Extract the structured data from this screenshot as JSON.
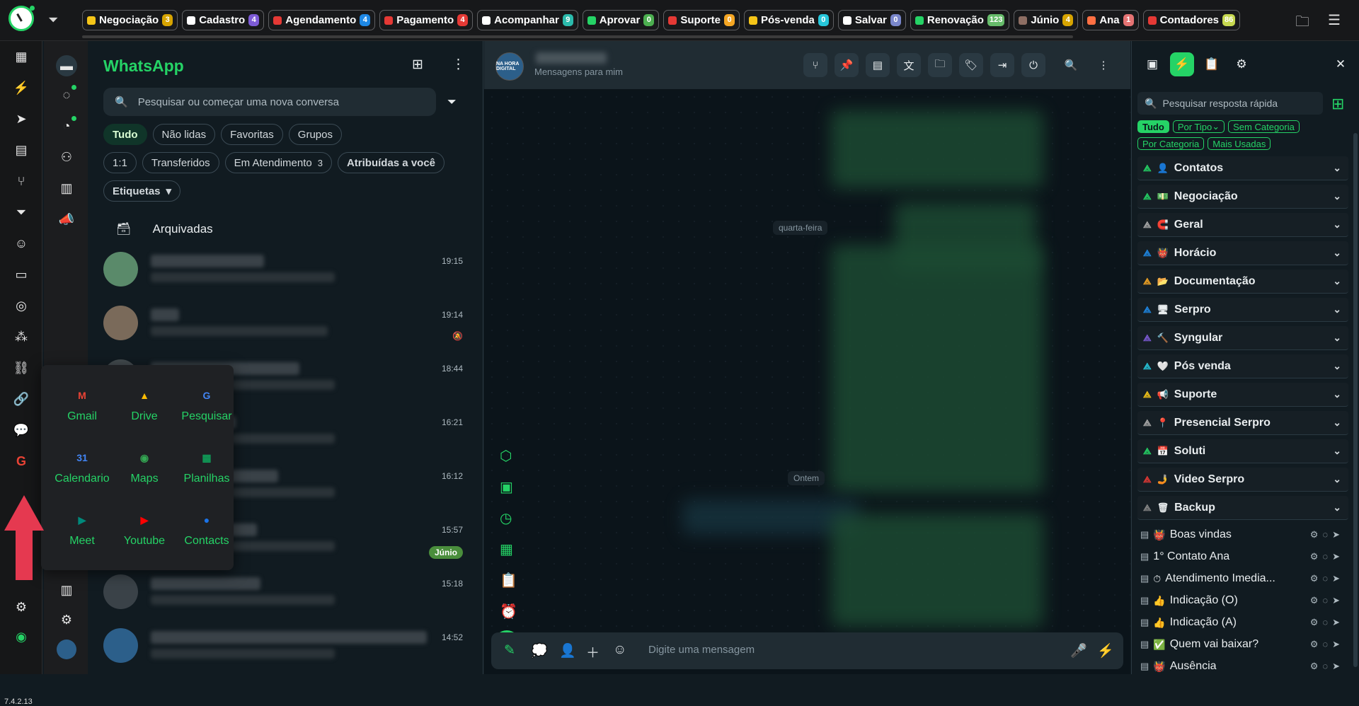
{
  "topbar": {
    "tags": [
      {
        "label": "Negociação",
        "count": "3",
        "color": "#f5c518",
        "count_bg": "#d7a400"
      },
      {
        "label": "Cadastro",
        "count": "4",
        "color": "#ffffff",
        "count_bg": "#7d5bd6"
      },
      {
        "label": "Agendamento",
        "count": "4",
        "color": "#e53935",
        "count_bg": "#1e88e5"
      },
      {
        "label": "Pagamento",
        "count": "4",
        "color": "#e53935",
        "count_bg": "#e53935"
      },
      {
        "label": "Acompanhar",
        "count": "9",
        "color": "#ffffff",
        "count_bg": "#2bbbad"
      },
      {
        "label": "Aprovar",
        "count": "0",
        "color": "#25d366",
        "count_bg": "#4caf50"
      },
      {
        "label": "Suporte",
        "count": "0",
        "color": "#e53935",
        "count_bg": "#f5a623"
      },
      {
        "label": "Pós-venda",
        "count": "0",
        "color": "#f5c518",
        "count_bg": "#26c6da"
      },
      {
        "label": "Salvar",
        "count": "0",
        "color": "#ffffff",
        "count_bg": "#7986cb"
      },
      {
        "label": "Renovação",
        "count": "123",
        "color": "#25d366",
        "count_bg": "#66bb6a"
      },
      {
        "label": "Júnio",
        "count": "4",
        "color": "#8d6e63",
        "count_bg": "#d7a400"
      },
      {
        "label": "Ana",
        "count": "1",
        "color": "#ff7043",
        "count_bg": "#e57373"
      },
      {
        "label": "Contadores",
        "count": "86",
        "color": "#e53935",
        "count_bg": "#c6d84f"
      }
    ]
  },
  "version": "7.4.2.13",
  "chatlist": {
    "title": "WhatsApp",
    "search_placeholder": "Pesquisar ou começar uma nova conversa",
    "filters_row1": [
      "Tudo",
      "Não lidas",
      "Favoritas",
      "Grupos"
    ],
    "filters_row2": [
      "1:1",
      "Transferidos",
      "Em Atendimento",
      "Atribuídas a você"
    ],
    "em_atendimento_count": "3",
    "etiquetas": "Etiquetas",
    "archived": "Arquivadas",
    "chats": [
      {
        "time": "19:15"
      },
      {
        "time": "19:14"
      },
      {
        "time": "18:44"
      },
      {
        "time": "16:21"
      },
      {
        "time": "16:12"
      },
      {
        "time": "15:57",
        "badge": "Júnio"
      },
      {
        "time": "15:18"
      },
      {
        "time": "14:52"
      }
    ]
  },
  "apps": [
    {
      "label": "Gmail",
      "icon": "gmail-icon"
    },
    {
      "label": "Drive",
      "icon": "drive-icon"
    },
    {
      "label": "Pesquisar",
      "icon": "google-icon"
    },
    {
      "label": "Calendario",
      "icon": "calendar-icon"
    },
    {
      "label": "Maps",
      "icon": "maps-icon"
    },
    {
      "label": "Planilhas",
      "icon": "sheets-icon"
    },
    {
      "label": "Meet",
      "icon": "meet-icon"
    },
    {
      "label": "Youtube",
      "icon": "youtube-icon"
    },
    {
      "label": "Contacts",
      "icon": "contacts-icon"
    }
  ],
  "chat": {
    "subtitle": "Mensagens para mim",
    "avatar_text": "NA HORA DIGITAL",
    "date1": "quarta-feira",
    "date2": "Ontem",
    "composer_placeholder": "Digite uma mensagem"
  },
  "rightpanel": {
    "search_placeholder": "Pesquisar resposta rápida",
    "pills_row1": [
      "Tudo",
      "Por Tipo",
      "Sem Categoria"
    ],
    "pills_row2": [
      "Por Categoria",
      "Mais Usadas"
    ],
    "categories": [
      {
        "label": "Contatos",
        "emoji": "👤",
        "tri_color": "#25d366"
      },
      {
        "label": "Negociação",
        "emoji": "💵",
        "tri_color": "#25d366"
      },
      {
        "label": "Geral",
        "emoji": "🧲",
        "tri_color": "#aaaaaa"
      },
      {
        "label": "Horácio",
        "emoji": "👹",
        "tri_color": "#1e88e5"
      },
      {
        "label": "Documentação",
        "emoji": "📂",
        "tri_color": "#f5a623"
      },
      {
        "label": "Serpro",
        "emoji": "🖥",
        "tri_color": "#1e88e5"
      },
      {
        "label": "Syngular",
        "emoji": "🔨",
        "tri_color": "#7d5bd6"
      },
      {
        "label": "Pós venda",
        "emoji": "🤍",
        "tri_color": "#26c6da"
      },
      {
        "label": "Suporte",
        "emoji": "📢",
        "tri_color": "#f5c518"
      },
      {
        "label": "Presencial Serpro",
        "emoji": "📍",
        "tri_color": "#aaaaaa"
      },
      {
        "label": "Soluti",
        "emoji": "📅",
        "tri_color": "#25d366"
      },
      {
        "label": "Video Serpro",
        "emoji": "🤳",
        "tri_color": "#e53935"
      },
      {
        "label": "Backup",
        "emoji": "🗑",
        "tri_color": "#888888"
      }
    ],
    "quick_replies": [
      {
        "label": "Boas vindas",
        "emoji": "👹"
      },
      {
        "label": "1° Contato Ana",
        "emoji": ""
      },
      {
        "label": "Atendimento Imedia...",
        "emoji": "⏱"
      },
      {
        "label": "Indicação (O)",
        "emoji": "👍"
      },
      {
        "label": "Indicação (A)",
        "emoji": "👍"
      },
      {
        "label": "Quem vai baixar?",
        "emoji": "✅"
      },
      {
        "label": "Ausência",
        "emoji": "👹"
      }
    ]
  }
}
